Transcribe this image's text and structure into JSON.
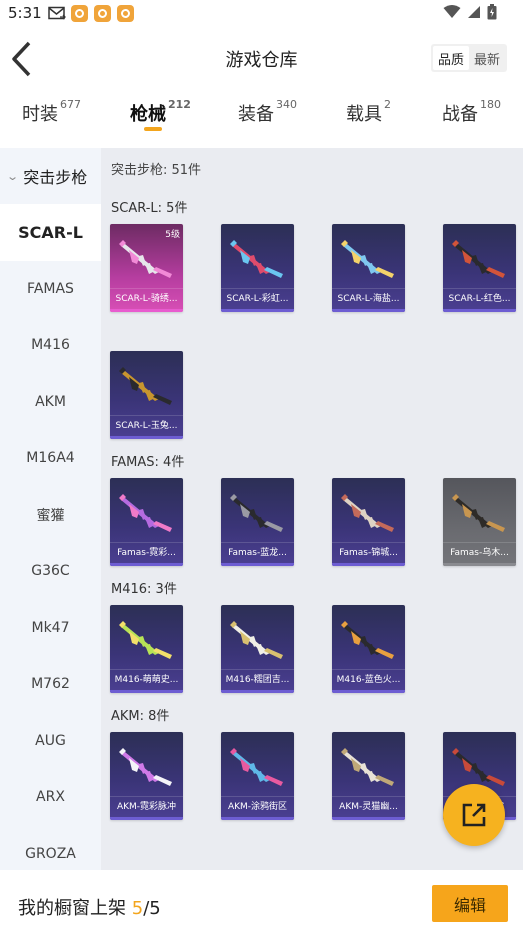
{
  "status_bar": {
    "time": "5:31"
  },
  "header": {
    "title": "游戏仓库",
    "sort_options": [
      "品质",
      "最新"
    ],
    "sort_selected": "品质"
  },
  "tabs": [
    {
      "label": "时装",
      "count": "677"
    },
    {
      "label": "枪械",
      "count": "212"
    },
    {
      "label": "装备",
      "count": "340"
    },
    {
      "label": "载具",
      "count": "2"
    },
    {
      "label": "战备",
      "count": "180"
    }
  ],
  "active_tab": "枪械",
  "sidebar": {
    "category": "突击步枪",
    "items": [
      "SCAR-L",
      "FAMAS",
      "M416",
      "AKM",
      "M16A4",
      "蜜獾",
      "G36C",
      "Mk47",
      "M762",
      "AUG",
      "ARX",
      "GROZA"
    ],
    "active": "SCAR-L"
  },
  "content": {
    "category_count": "突击步枪: 51件",
    "sections": [
      {
        "label": "SCAR-L: 5件",
        "items": [
          {
            "name": "SCAR-L-骑绣...",
            "level": "5级",
            "style": "pink",
            "gun_color": "#e6e6ea",
            "accent": "#f28ad7"
          },
          {
            "name": "SCAR-L-彩虹...",
            "level": "",
            "style": "purple",
            "gun_color": "#e04c6c",
            "accent": "#6ac6f0"
          },
          {
            "name": "SCAR-L-海盐...",
            "level": "",
            "style": "purple",
            "gun_color": "#7fc8ef",
            "accent": "#f4d36a"
          },
          {
            "name": "SCAR-L-红色...",
            "level": "",
            "style": "purple",
            "gun_color": "#2a2a2e",
            "accent": "#d2543a"
          },
          {
            "name": "SCAR-L-玉兔...",
            "level": "",
            "style": "purple",
            "gun_color": "#c8962e",
            "accent": "#2a2a2e"
          }
        ]
      },
      {
        "label": "FAMAS: 4件",
        "items": [
          {
            "name": "Famas-霓彩...",
            "level": "",
            "style": "purple",
            "gun_color": "#b56be0",
            "accent": "#f07ac8"
          },
          {
            "name": "Famas-蓝龙...",
            "level": "",
            "style": "purple",
            "gun_color": "#2a2a2e",
            "accent": "#9a9aa4"
          },
          {
            "name": "Famas-锦城...",
            "level": "",
            "style": "purple",
            "gun_color": "#ded3c4",
            "accent": "#c46a5a"
          },
          {
            "name": "Famas-乌木...",
            "level": "",
            "style": "gray",
            "gun_color": "#2e2b28",
            "accent": "#c89650"
          }
        ]
      },
      {
        "label": "M416: 3件",
        "items": [
          {
            "name": "M416-萌萌史...",
            "level": "",
            "style": "purple",
            "gun_color": "#b7e356",
            "accent": "#f2e06a"
          },
          {
            "name": "M416-糯团吉...",
            "level": "",
            "style": "purple",
            "gun_color": "#f0efe6",
            "accent": "#d8c070"
          },
          {
            "name": "M416-蓝色火...",
            "level": "",
            "style": "purple",
            "gun_color": "#2a2a2e",
            "accent": "#e8a040"
          }
        ]
      },
      {
        "label": "AKM: 8件",
        "items": [
          {
            "name": "AKM-霓彩脉冲",
            "level": "",
            "style": "purple",
            "gun_color": "#d07ae8",
            "accent": "#f4f4f8"
          },
          {
            "name": "AKM-涂鸦街区",
            "level": "",
            "style": "purple",
            "gun_color": "#5fb8e8",
            "accent": "#e85aa0"
          },
          {
            "name": "AKM-灵猫幽...",
            "level": "",
            "style": "purple",
            "gun_color": "#e8e2d6",
            "accent": "#c0a878"
          },
          {
            "name": "AKM-...徽章",
            "level": "",
            "style": "purple",
            "gun_color": "#2a2a2e",
            "accent": "#c84a3a"
          }
        ]
      }
    ]
  },
  "footer": {
    "label": "我的橱窗上架",
    "current": "5",
    "separator": "/",
    "max": "5",
    "edit_label": "编辑"
  }
}
